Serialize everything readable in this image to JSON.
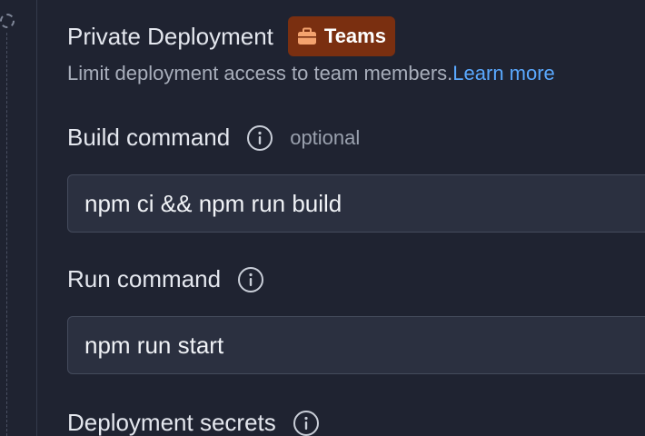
{
  "private_deployment": {
    "title": "Private Deployment",
    "badge_label": "Teams",
    "description": "Limit deployment access to team members.",
    "learn_more": "Learn more"
  },
  "build_command": {
    "label": "Build command",
    "hint": "optional",
    "value": "npm ci && npm run build"
  },
  "run_command": {
    "label": "Run command",
    "value": "npm run start"
  },
  "deployment_secrets": {
    "label": "Deployment secrets"
  },
  "colors": {
    "background": "#1f2331",
    "badge_bg": "#7a2f10",
    "badge_icon": "#f4a36f",
    "link": "#5aa9ff",
    "input_bg": "#2b3040"
  },
  "icons": {
    "badge": "briefcase-icon",
    "info": "info-icon",
    "step": "dashed-circle-icon"
  }
}
